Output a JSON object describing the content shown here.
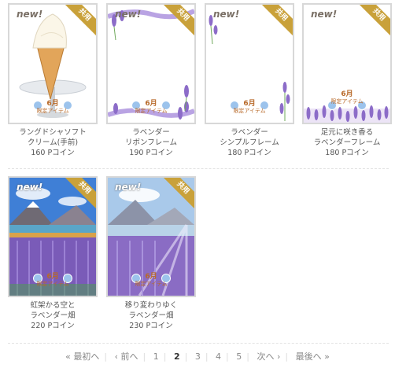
{
  "items": [
    {
      "name1": "ラングドシャソフト",
      "name2": "クリーム(手前)",
      "price": "160 Pコイン",
      "new": "new!",
      "shared": "共用",
      "month": "6月",
      "limited": "限定アイテム"
    },
    {
      "name1": "ラベンダー",
      "name2": "リボンフレーム",
      "price": "190 Pコイン",
      "new": "new!",
      "shared": "共用",
      "month": "6月",
      "limited": "限定アイテム"
    },
    {
      "name1": "ラベンダー",
      "name2": "シンプルフレーム",
      "price": "180 Pコイン",
      "new": "new!",
      "shared": "共用",
      "month": "6月",
      "limited": "限定アイテム"
    },
    {
      "name1": "足元に咲き香る",
      "name2": "ラベンダーフレーム",
      "price": "180 Pコイン",
      "new": "new!",
      "shared": "共用",
      "month": "6月",
      "limited": "限定アイテム"
    },
    {
      "name1": "虹架かる空と",
      "name2": "ラベンダー畑",
      "price": "220 Pコイン",
      "new": "new!",
      "shared": "共用",
      "month": "6月",
      "limited": "限定アイテム"
    },
    {
      "name1": "移り変わりゆく",
      "name2": "ラベンダー畑",
      "price": "230 Pコイン",
      "new": "new!",
      "shared": "共用",
      "month": "6月",
      "limited": "限定アイテム"
    }
  ],
  "pagination": {
    "first": "« 最初へ",
    "prev": "‹ 前へ",
    "pages": [
      "1",
      "2",
      "3",
      "4",
      "5"
    ],
    "current": "2",
    "next": "次へ ›",
    "last": "最後へ »"
  },
  "colors": {
    "ribbon": "#c9a13a",
    "lavender": "#8c6cc8",
    "border": "#d8d8d8"
  }
}
